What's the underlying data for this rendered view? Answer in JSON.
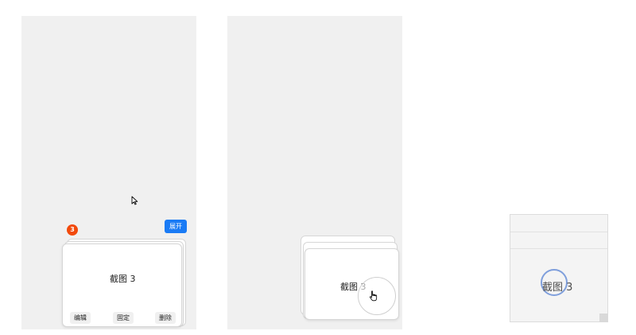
{
  "frame_1": {
    "badge_count": "3",
    "expand_label": "展开",
    "card_title": "截图 3",
    "actions": [
      {
        "label": "编辑"
      },
      {
        "label": "固定"
      },
      {
        "label": "删除"
      }
    ]
  },
  "frame_2": {
    "card_title": "截图 3"
  },
  "frame_3": {
    "card_title": "截图 3"
  },
  "colors": {
    "panel_bg": "#f0f0f0",
    "badge": "#f24a0b",
    "accent": "#1a7bf5",
    "card_bg": "#ffffff",
    "ripple": "#7f9fdc"
  },
  "icons": [
    "arrow-cursor-icon",
    "hand-pointer-icon"
  ]
}
